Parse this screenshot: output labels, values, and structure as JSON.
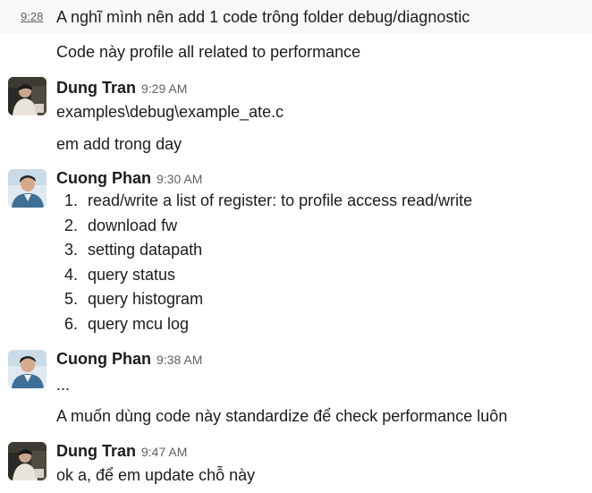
{
  "messages": {
    "m1": {
      "hover_time": "9:28",
      "text": "A nghĩ mình nên add 1 code trông folder debug/diagnostic"
    },
    "m2": {
      "text": "Code này profile all related to performance"
    },
    "m3": {
      "sender": "Dung Tran",
      "time": "9:29 AM",
      "lines": [
        "examples\\debug\\example_ate.c",
        "em add trong day"
      ]
    },
    "m4": {
      "sender": "Cuong Phan",
      "time": "9:30 AM",
      "list": [
        {
          "num": "1.",
          "text": "read/write a list of register: to profile access read/write"
        },
        {
          "num": "2.",
          "text": "download fw"
        },
        {
          "num": "3.",
          "text": "setting datapath"
        },
        {
          "num": "4.",
          "text": "query status"
        },
        {
          "num": "5.",
          "text": "query histogram"
        },
        {
          "num": "6.",
          "text": "query mcu log"
        }
      ]
    },
    "m5": {
      "sender": "Cuong Phan",
      "time": "9:38 AM",
      "lines": [
        "...",
        "A muốn dùng code này standardize để check performance luôn"
      ]
    },
    "m6": {
      "sender": "Dung Tran",
      "time": "9:47 AM",
      "lines": [
        "ok a, để em update chỗ này"
      ]
    }
  }
}
